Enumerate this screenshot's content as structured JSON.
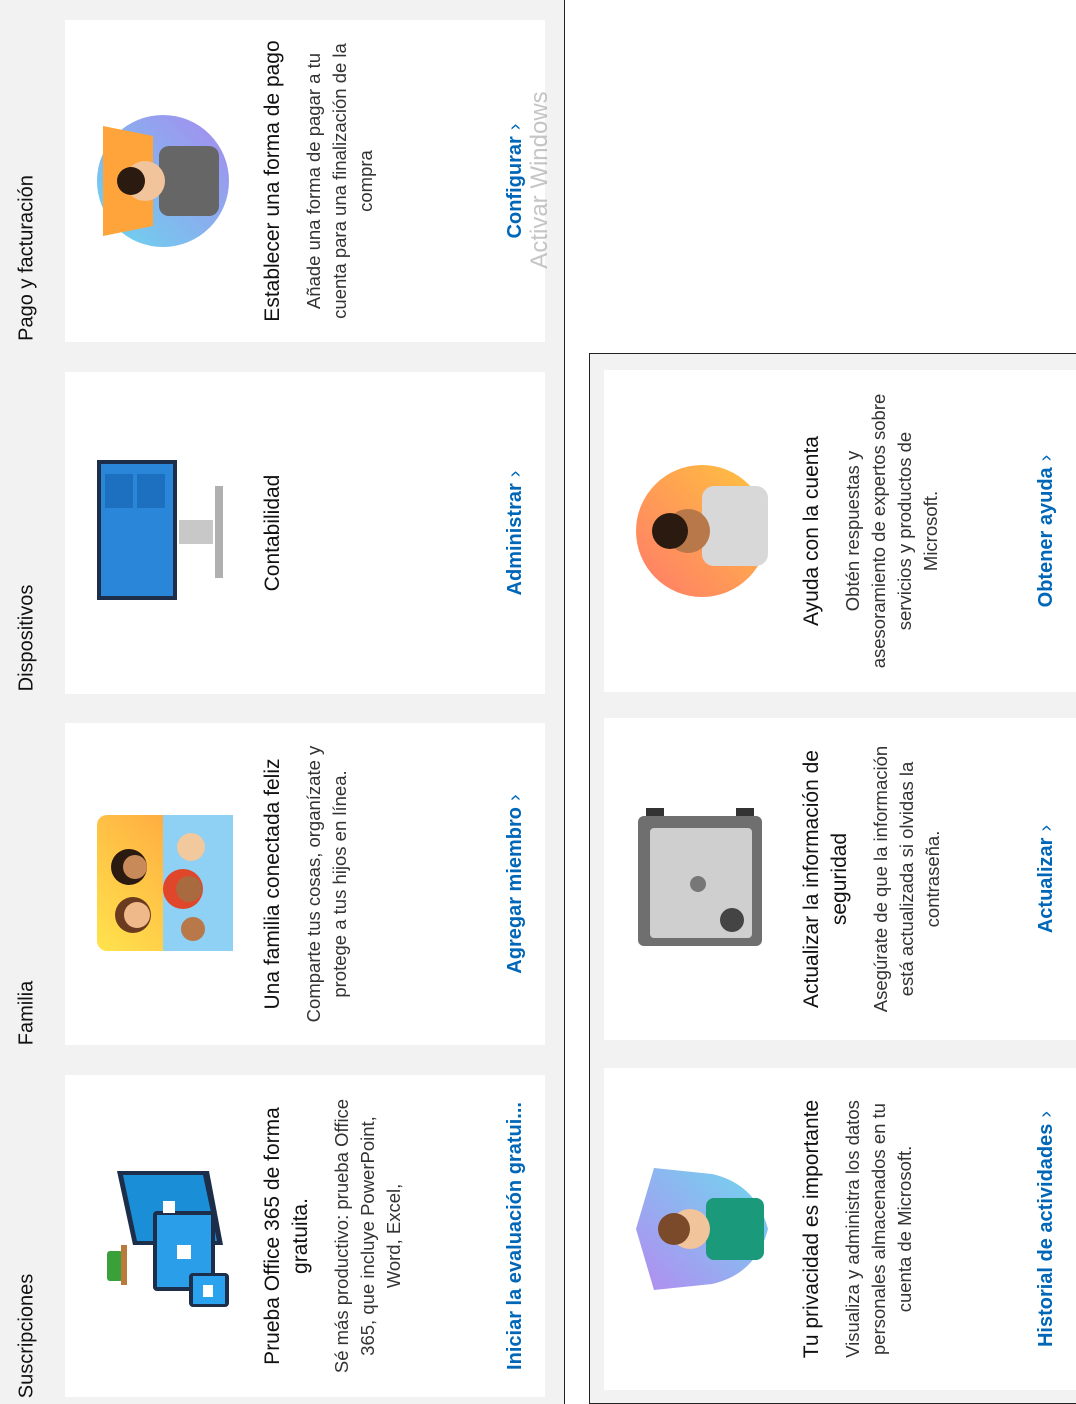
{
  "sections": {
    "suscripciones": "Suscripciones",
    "familia": "Familia",
    "dispositivos": "Dispositivos",
    "pago": "Pago y facturación"
  },
  "cards": {
    "office": {
      "title": "Prueba Office 365 de forma gratuita.",
      "desc": "Sé más productivo: prueba Office 365, que incluye PowerPoint, Word, Excel,",
      "link": "Iniciar la evaluación gratui..."
    },
    "familia": {
      "title": "Una familia conectada feliz",
      "desc": "Comparte tus cosas, organízate y protege a tus hijos en línea.",
      "link": "Agregar miembro"
    },
    "contabilidad": {
      "title": "Contabilidad",
      "desc": "",
      "link": "Administrar"
    },
    "pago": {
      "title": "Establecer una forma de pago",
      "desc": "Añade una forma de pagar a tu cuenta para una finalización de la compra",
      "link": "Configurar"
    },
    "privacidad": {
      "title": "Tu privacidad es importante",
      "desc": "Visualiza y administra los datos personales almacenados en tu cuenta de Microsoft.",
      "link": "Historial de actividades"
    },
    "seguridad": {
      "title": "Actualizar la información de seguridad",
      "desc": "Asegúrate de que la información está actualizada si olvidas la contraseña.",
      "link": "Actualizar"
    },
    "ayuda": {
      "title": "Ayuda con la cuenta",
      "desc": "Obtén respuestas y asesoramiento de expertos sobre servicios y productos de Microsoft.",
      "link": "Obtener ayuda"
    }
  },
  "chevron": "›",
  "watermark": "Activar Windows",
  "colors": {
    "link": "#0067b8",
    "panel_bg": "#f2f2f2",
    "card_bg": "#ffffff"
  }
}
